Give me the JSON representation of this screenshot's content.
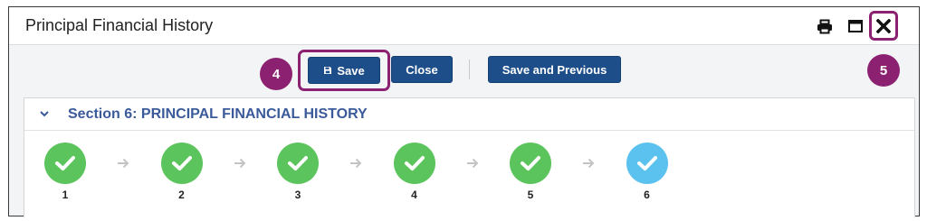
{
  "window": {
    "title": "Principal Financial History",
    "icons": [
      "printer-icon",
      "maximize-icon",
      "close-icon"
    ]
  },
  "toolbar": {
    "save_label": "Save",
    "close_label": "Close",
    "save_previous_label": "Save and Previous"
  },
  "callouts": {
    "save": "4",
    "close": "5"
  },
  "section": {
    "title": "Section 6: PRINCIPAL FINANCIAL HISTORY",
    "expanded": true
  },
  "steps": [
    {
      "number": "1",
      "status": "complete"
    },
    {
      "number": "2",
      "status": "complete"
    },
    {
      "number": "3",
      "status": "complete"
    },
    {
      "number": "4",
      "status": "complete"
    },
    {
      "number": "5",
      "status": "complete"
    },
    {
      "number": "6",
      "status": "current"
    }
  ],
  "colors": {
    "accent": "#1d4e89",
    "callout": "#8b2170",
    "complete": "#5cc45c",
    "current": "#5bc1ef",
    "section_title": "#3a5a9a"
  }
}
